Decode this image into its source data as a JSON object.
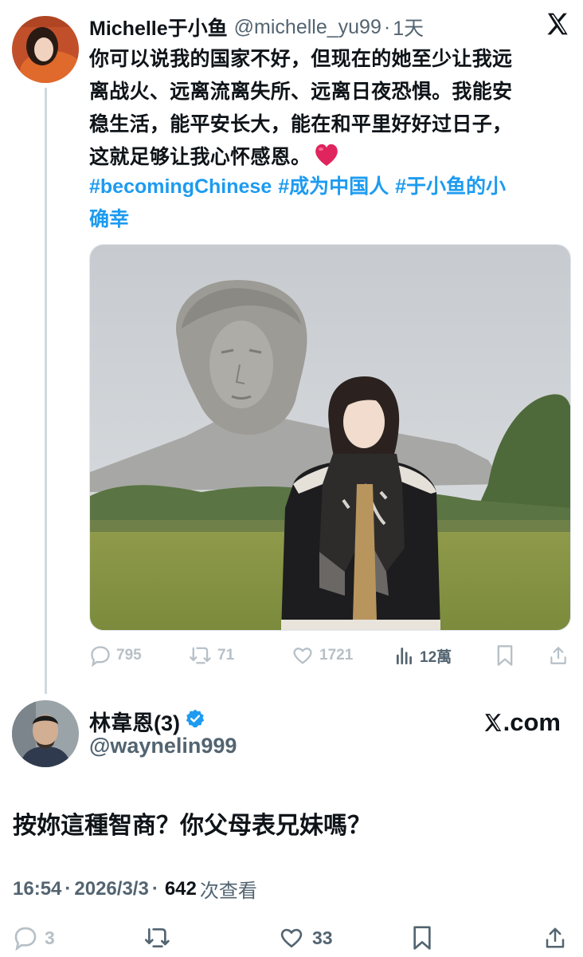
{
  "quoted_tweet": {
    "name": "Michelle于小鱼",
    "handle": "@michelle_yu99",
    "dot": "·",
    "time": "1天",
    "text_lines": [
      "你可以说我的国家不好，但现在的她至少让我远",
      "离战火、远离流离失所、远离日夜恐惧。我能安",
      "稳生活，能平安长大，能在和平里好好过日子，",
      "这就足够让我心怀感恩。"
    ],
    "hashtags_line1": [
      "#becomingChinese",
      "#成为中国人",
      "#于小鱼的小"
    ],
    "hashtags_line2": "确幸",
    "stats": {
      "replies": "795",
      "retweets": "71",
      "likes": "1721",
      "views": "12萬"
    }
  },
  "main_tweet": {
    "name": "林韋恩(3)",
    "handle": "@waynelin999",
    "brand": ".com",
    "text": "按妳這種智商？你父母表兄妹嗎？",
    "time": "16:54",
    "dot": "·",
    "date": "2026/3/3",
    "dot2": "·",
    "views_count": "642",
    "views_label": "次查看",
    "stats": {
      "replies": "3",
      "likes": "33"
    }
  },
  "colors": {
    "accent": "#1d9bf0",
    "text": "#0f1419",
    "secondary": "#536471",
    "faded": "#b7c0c7",
    "heart": "#e0245e"
  },
  "icons": [
    "x-logo",
    "heart-emoji",
    "reply-icon",
    "retweet-icon",
    "like-icon",
    "views-icon",
    "bookmark-icon",
    "share-icon",
    "verified-icon"
  ]
}
